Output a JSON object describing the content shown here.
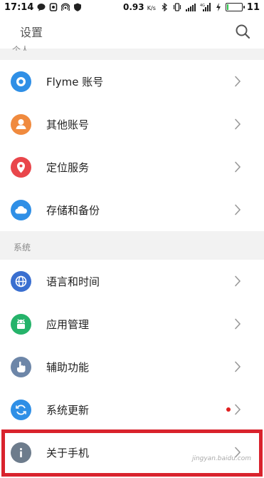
{
  "status_bar": {
    "time": "17:14",
    "net_speed": "0.93",
    "net_speed_unit": "K/s",
    "battery_level": "11",
    "battery_fraction": 0.11,
    "battery_color": "#2cc64a",
    "icons": [
      "message-icon",
      "notification-icon",
      "hotspot-icon",
      "shield-icon",
      "bluetooth-icon",
      "vibrate-icon",
      "signal-icon",
      "4g-signal-icon",
      "charging-icon"
    ]
  },
  "header": {
    "title": "设置",
    "search_icon": "search-icon"
  },
  "partial_section_label": "个人",
  "personal_items": [
    {
      "label": "Flyme 账号",
      "icon": "flyme-account-icon",
      "color": "#2f8fe6"
    },
    {
      "label": "其他账号",
      "icon": "user-icon",
      "color": "#f08a3e"
    },
    {
      "label": "定位服务",
      "icon": "location-pin-icon",
      "color": "#e9464b"
    },
    {
      "label": "存储和备份",
      "icon": "cloud-icon",
      "color": "#2f8fe6"
    }
  ],
  "system_section_label": "系统",
  "system_items": [
    {
      "label": "语言和时间",
      "icon": "globe-icon",
      "color": "#3a6fd0"
    },
    {
      "label": "应用管理",
      "icon": "android-icon",
      "color": "#25b36a"
    },
    {
      "label": "辅助功能",
      "icon": "hand-pointer-icon",
      "color": "#6d86a8"
    },
    {
      "label": "系统更新",
      "icon": "update-icon",
      "color": "#2f8fe6",
      "has_badge": true,
      "badge_color": "#e02020"
    },
    {
      "label": "关于手机",
      "icon": "info-icon",
      "color": "#6d7c8c"
    }
  ],
  "watermark": "jingyan.baidu.com",
  "highlight_color": "#d9232d"
}
